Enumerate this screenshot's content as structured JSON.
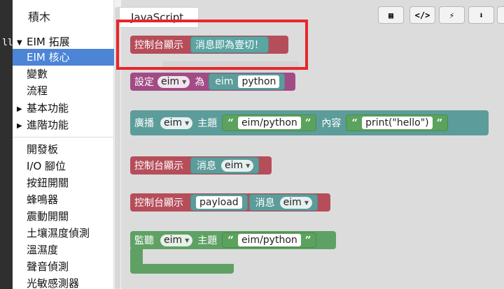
{
  "left_strip": {
    "mark": "ll"
  },
  "category_panel": {
    "tab_label": "積木",
    "items": [
      {
        "label": "EIM 拓展",
        "expandable": true,
        "expanded": true
      },
      {
        "label": "EIM 核心",
        "active": true
      },
      {
        "label": "變數"
      },
      {
        "label": "流程"
      },
      {
        "label": "基本功能",
        "expandable": true
      },
      {
        "label": "進階功能",
        "expandable": true
      }
    ],
    "items2": [
      {
        "label": "開發板"
      },
      {
        "label": "I/O 腳位"
      },
      {
        "label": "按鈕開關"
      },
      {
        "label": "蜂鳴器"
      },
      {
        "label": "震動開關"
      },
      {
        "label": "土壤濕度偵測"
      },
      {
        "label": "溫濕度"
      },
      {
        "label": "聲音偵測"
      },
      {
        "label": "光敏感測器"
      }
    ]
  },
  "workspace": {
    "code_tab": "JavaScript",
    "toolbar": [
      {
        "icon": "qr-code-icon",
        "glyph": "▦"
      },
      {
        "icon": "code-icon",
        "glyph": "</>"
      },
      {
        "icon": "lightning-icon",
        "glyph": "⚡"
      },
      {
        "icon": "download-box-icon",
        "glyph": "⬇"
      }
    ]
  },
  "blocks": {
    "console_msg": {
      "label": "控制台顯示",
      "value": "消息即為壹切！"
    },
    "set_var": {
      "label": "設定",
      "var": "eim",
      "as": "為",
      "field_eim": "eim",
      "field_py": "python"
    },
    "broadcast": {
      "label": "廣播",
      "var": "eim",
      "topic": "主題",
      "topic_str": "eim/python",
      "content": "內容",
      "content_str": "print(\"hello\")"
    },
    "console_message_var": {
      "label": "控制台顯示",
      "msg": "消息",
      "var": "eim"
    },
    "console_payload": {
      "label": "控制台顯示",
      "payload": "payload",
      "msg": "消息",
      "var": "eim"
    },
    "listen": {
      "label": "監聽",
      "var": "eim",
      "topic": "主題",
      "topic_str": "eim/python"
    }
  },
  "colors": {
    "accent_selection": "#4c84d6",
    "console_block": "#b54e5a",
    "variable_block": "#a24c86",
    "eim_block": "#5c9d9b",
    "string_block": "#5fa165",
    "highlight": "#e8262c"
  }
}
